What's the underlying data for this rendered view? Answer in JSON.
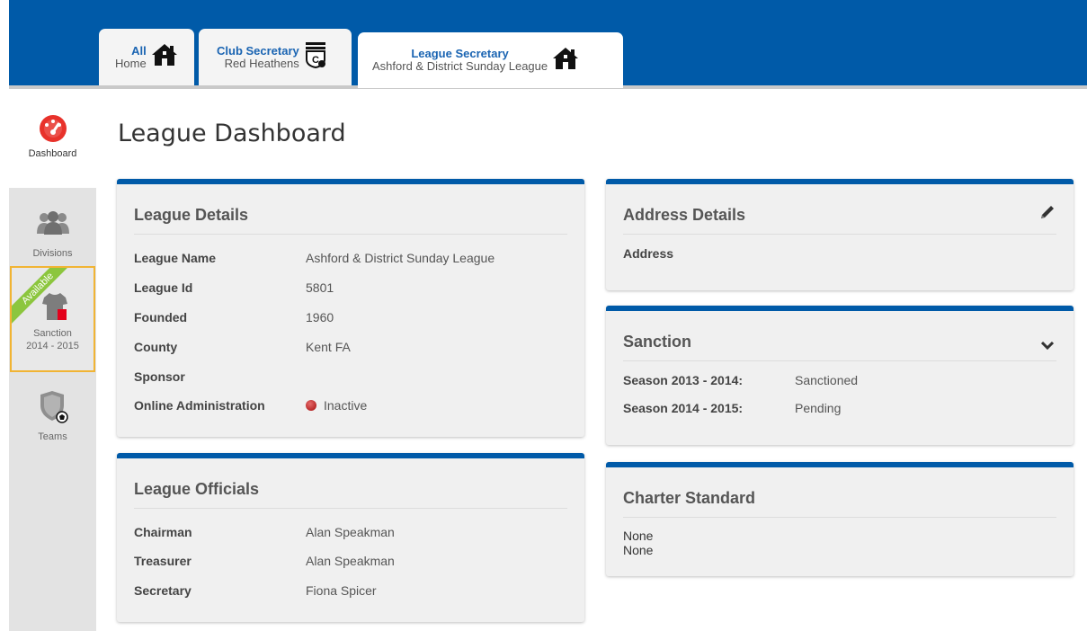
{
  "tabs": {
    "all": {
      "line1": "All",
      "line2": "Home",
      "icon": "house-icon"
    },
    "club": {
      "line1": "Club Secretary",
      "line2": "Red Heathens",
      "icon": "club-shield-icon"
    },
    "league": {
      "line1": "League Secretary",
      "line2": "Ashford & District Sunday League",
      "icon": "house-icon"
    }
  },
  "sidebar": {
    "items": [
      {
        "label": "Dashboard",
        "icon": "dashboard-gauge-icon"
      },
      {
        "label": "Divisions",
        "icon": "people-group-icon"
      },
      {
        "label_line1": "Sanction",
        "label_line2": "2014 - 2015",
        "ribbon": "Available",
        "icon": "shirt-red-card-icon"
      },
      {
        "label": "Teams",
        "icon": "shield-ball-icon"
      }
    ]
  },
  "page": {
    "title": "League Dashboard"
  },
  "league_details": {
    "title": "League Details",
    "rows": [
      {
        "key": "League Name",
        "value": "Ashford & District Sunday League"
      },
      {
        "key": "League Id",
        "value": "5801"
      },
      {
        "key": "Founded",
        "value": "1960"
      },
      {
        "key": "County",
        "value": "Kent FA"
      },
      {
        "key": "Sponsor",
        "value": ""
      },
      {
        "key": "Online Administration",
        "value": "Inactive"
      }
    ]
  },
  "league_officials": {
    "title": "League Officials",
    "rows": [
      {
        "key": "Chairman",
        "value": "Alan Speakman"
      },
      {
        "key": "Treasurer",
        "value": "Alan Speakman"
      },
      {
        "key": "Secretary",
        "value": "Fiona Spicer"
      }
    ]
  },
  "address_details": {
    "title": "Address Details",
    "address_label": "Address"
  },
  "sanction": {
    "title": "Sanction",
    "rows": [
      {
        "key": "Season 2013 - 2014:",
        "value": "Sanctioned"
      },
      {
        "key": "Season 2014 - 2015:",
        "value": "Pending"
      }
    ]
  },
  "charter_standard": {
    "title": "Charter Standard",
    "lines": [
      "None",
      "None"
    ]
  },
  "colors": {
    "brand_blue": "#005aa8",
    "sanction_highlight": "#f1b434",
    "ribbon_green": "#8cc63e",
    "inactive_red": "#a50d0d"
  }
}
